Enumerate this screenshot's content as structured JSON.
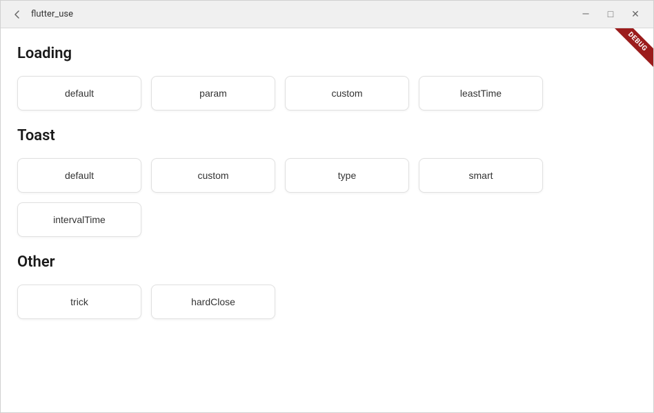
{
  "window": {
    "title": "flutter_use",
    "controls": {
      "minimize": "—",
      "maximize": "□",
      "close": "✕"
    }
  },
  "debug_badge": "DEBUG",
  "sections": [
    {
      "id": "loading",
      "title": "Loading",
      "buttons": [
        {
          "id": "loading-default",
          "label": "default"
        },
        {
          "id": "loading-param",
          "label": "param"
        },
        {
          "id": "loading-custom",
          "label": "custom"
        },
        {
          "id": "loading-leasttime",
          "label": "leastTime"
        }
      ]
    },
    {
      "id": "toast",
      "title": "Toast",
      "buttons": [
        {
          "id": "toast-default",
          "label": "default"
        },
        {
          "id": "toast-custom",
          "label": "custom"
        },
        {
          "id": "toast-type",
          "label": "type"
        },
        {
          "id": "toast-smart",
          "label": "smart"
        },
        {
          "id": "toast-intervaltime",
          "label": "intervalTime"
        }
      ]
    },
    {
      "id": "other",
      "title": "Other",
      "buttons": [
        {
          "id": "other-trick",
          "label": "trick"
        },
        {
          "id": "other-hardclose",
          "label": "hardClose"
        }
      ]
    }
  ]
}
